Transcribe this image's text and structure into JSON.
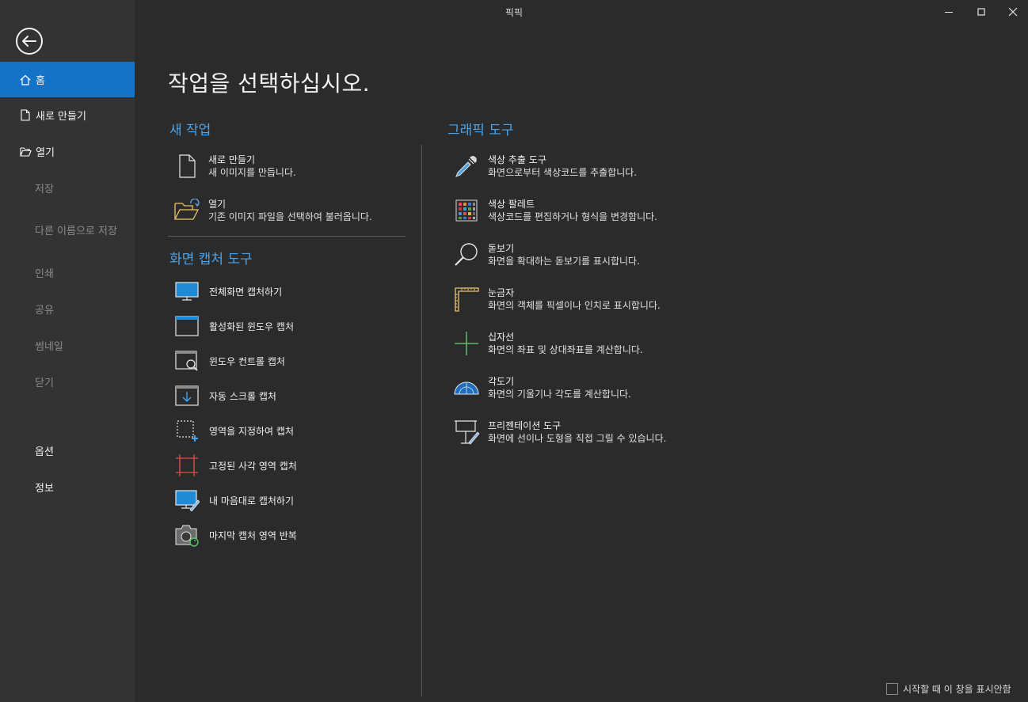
{
  "window": {
    "title": "픽픽"
  },
  "sidebar": {
    "items": [
      {
        "label": "홈",
        "icon": "home-icon"
      },
      {
        "label": "새로 만들기",
        "icon": "new-file-icon"
      },
      {
        "label": "열기",
        "icon": "open-folder-icon"
      },
      {
        "label": "저장"
      },
      {
        "label": "다른 이름으로 저장"
      },
      {
        "label": "인쇄"
      },
      {
        "label": "공유"
      },
      {
        "label": "썸네일"
      },
      {
        "label": "닫기"
      },
      {
        "label": "옵션"
      },
      {
        "label": "정보"
      }
    ]
  },
  "main": {
    "title": "작업을 선택하십시오.",
    "new_task": {
      "heading": "새 작업",
      "items": [
        {
          "name": "새로 만들기",
          "desc": "새 이미지를 만듭니다.",
          "icon": "blank-document-icon"
        },
        {
          "name": "열기",
          "desc": "기존 이미지 파일을 선택하여 불러옵니다.",
          "icon": "open-folder-icon"
        }
      ]
    },
    "capture": {
      "heading": "화면 캡처 도구",
      "items": [
        {
          "name": "전체화면 캡처하기",
          "icon": "monitor-icon"
        },
        {
          "name": "활성화된 윈도우 캡처",
          "icon": "window-icon"
        },
        {
          "name": "윈도우 컨트롤 캡처",
          "icon": "window-magnifier-icon"
        },
        {
          "name": "자동 스크롤 캡처",
          "icon": "scroll-down-icon"
        },
        {
          "name": "영역을 지정하여 캡처",
          "icon": "dashed-region-icon"
        },
        {
          "name": "고정된 사각 영역 캡처",
          "icon": "fixed-rect-icon"
        },
        {
          "name": "내 마음대로 캡처하기",
          "icon": "monitor-pen-icon"
        },
        {
          "name": "마지막 캡처 영역 반복",
          "icon": "camera-repeat-icon"
        }
      ]
    },
    "graphics": {
      "heading": "그래픽 도구",
      "items": [
        {
          "name": "색상 추출 도구",
          "desc": "화면으로부터 색상코드를 추출합니다.",
          "icon": "eyedropper-icon"
        },
        {
          "name": "색상 팔레트",
          "desc": "색상코드를 편집하거나 형식을 변경합니다.",
          "icon": "palette-icon"
        },
        {
          "name": "돋보기",
          "desc": "화면을 확대하는 돋보기를 표시합니다.",
          "icon": "magnifier-icon"
        },
        {
          "name": "눈금자",
          "desc": "화면의 객체를 픽셀이나 인치로 표시합니다.",
          "icon": "ruler-icon"
        },
        {
          "name": "십자선",
          "desc": "화면의 좌표 및 상대좌표를 계산합니다.",
          "icon": "crosshair-icon"
        },
        {
          "name": "각도기",
          "desc": "화면의 기울기나 각도를 계산합니다.",
          "icon": "protractor-icon"
        },
        {
          "name": "프리젠테이션 도구",
          "desc": "화면에 선이나 도형을 직접 그릴 수 있습니다.",
          "icon": "presentation-icon"
        }
      ]
    }
  },
  "footer": {
    "startup_label": "시작할 때 이 창을 표시안함",
    "startup_checked": false
  },
  "colors": {
    "accent": "#1473c6",
    "heading": "#4aa3ea",
    "background": "#2b2b2b",
    "sidebar": "#333333"
  }
}
